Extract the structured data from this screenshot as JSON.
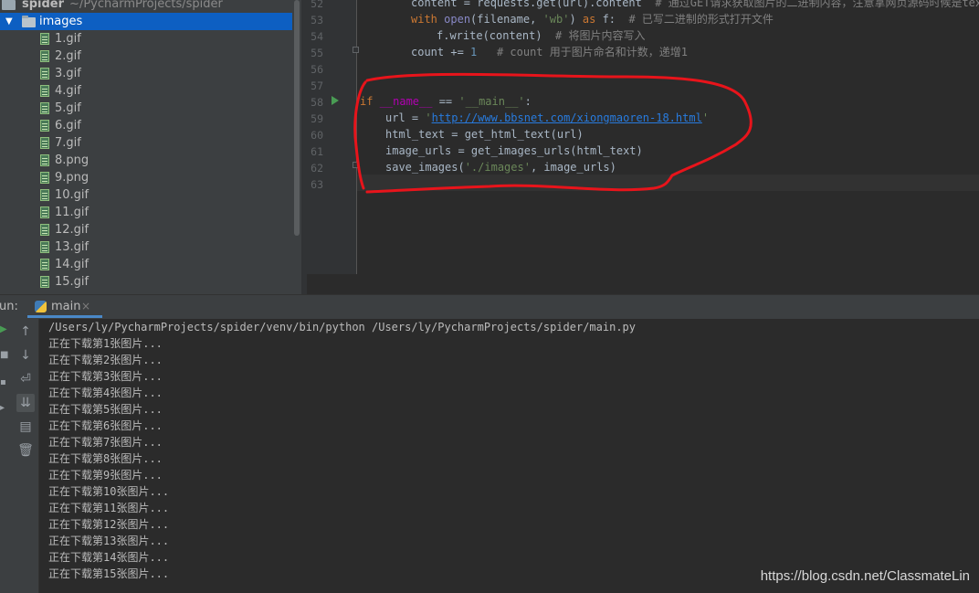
{
  "project_tree": {
    "root_name": "spider",
    "root_path": "~/PycharmProjects/spider",
    "folder_name": "images",
    "files": [
      "1.gif",
      "2.gif",
      "3.gif",
      "4.gif",
      "5.gif",
      "6.gif",
      "7.gif",
      "8.png",
      "9.png",
      "10.gif",
      "11.gif",
      "12.gif",
      "13.gif",
      "14.gif",
      "15.gif"
    ]
  },
  "editor": {
    "line_numbers": [
      "52",
      "53",
      "54",
      "55",
      "56",
      "57",
      "58",
      "59",
      "60",
      "61",
      "62",
      "63"
    ],
    "code": {
      "l52_a": "content = requests.get(url).content",
      "l52_c": "# 通过GET请求获取图片的二进制内容，注意拿网页源码时候是text",
      "l53_with": "with",
      "l53_open": "open",
      "l53_args": "(filename, ",
      "l53_wb": "'wb'",
      "l53_close": ") ",
      "l53_as": "as",
      "l53_f": " f:  ",
      "l53_c": "# 已写二进制的形式打开文件",
      "l54_a": "f.write(content)  ",
      "l54_c": "# 将图片内容写入",
      "l55_a": "count += ",
      "l55_num": "1",
      "l55_c": "# count 用于图片命名和计数，递增1",
      "l58_if": "if",
      "l58_name": "__name__",
      "l58_eq": " == ",
      "l58_main": "'__main__'",
      "l58_colon": ":",
      "l59_a": "url = ",
      "l59_q1": "'",
      "l59_url": "http://www.bbsnet.com/xiongmaoren-18.html",
      "l59_q2": "'",
      "l60_a": "html_text = get_html_text(url)",
      "l61_a": "image_urls = get_images_urls(html_text)",
      "l62_a": "save_images(",
      "l62_str": "'./images'",
      "l62_b": ", image_urls)"
    }
  },
  "run_panel": {
    "label": "un:",
    "tab_name": "main",
    "tab_close": "×",
    "command": "/Users/ly/PycharmProjects/spider/venv/bin/python /Users/ly/PycharmProjects/spider/main.py",
    "output": [
      "正在下载第1张图片...",
      "正在下载第2张图片...",
      "正在下载第3张图片...",
      "正在下载第4张图片...",
      "正在下载第5张图片...",
      "正在下载第6张图片...",
      "正在下载第7张图片...",
      "正在下载第8张图片...",
      "正在下载第9张图片...",
      "正在下载第10张图片...",
      "正在下载第11张图片...",
      "正在下载第12张图片...",
      "正在下载第13张图片...",
      "正在下载第14张图片...",
      "正在下载第15张图片..."
    ]
  },
  "watermark": "https://blog.csdn.net/ClassmateLin",
  "icons": [
    "folder-icon",
    "gif-file-icon",
    "python-icon",
    "run-arrow-icon",
    "up-arrow-icon",
    "down-arrow-icon",
    "soft-wrap-icon",
    "scroll-to-end-icon",
    "print-icon",
    "trash-icon"
  ],
  "colors": {
    "selection": "#0d5fc2",
    "annotation_circle": "#e8141b",
    "keyword": "#cc7832",
    "string": "#6a8759"
  }
}
